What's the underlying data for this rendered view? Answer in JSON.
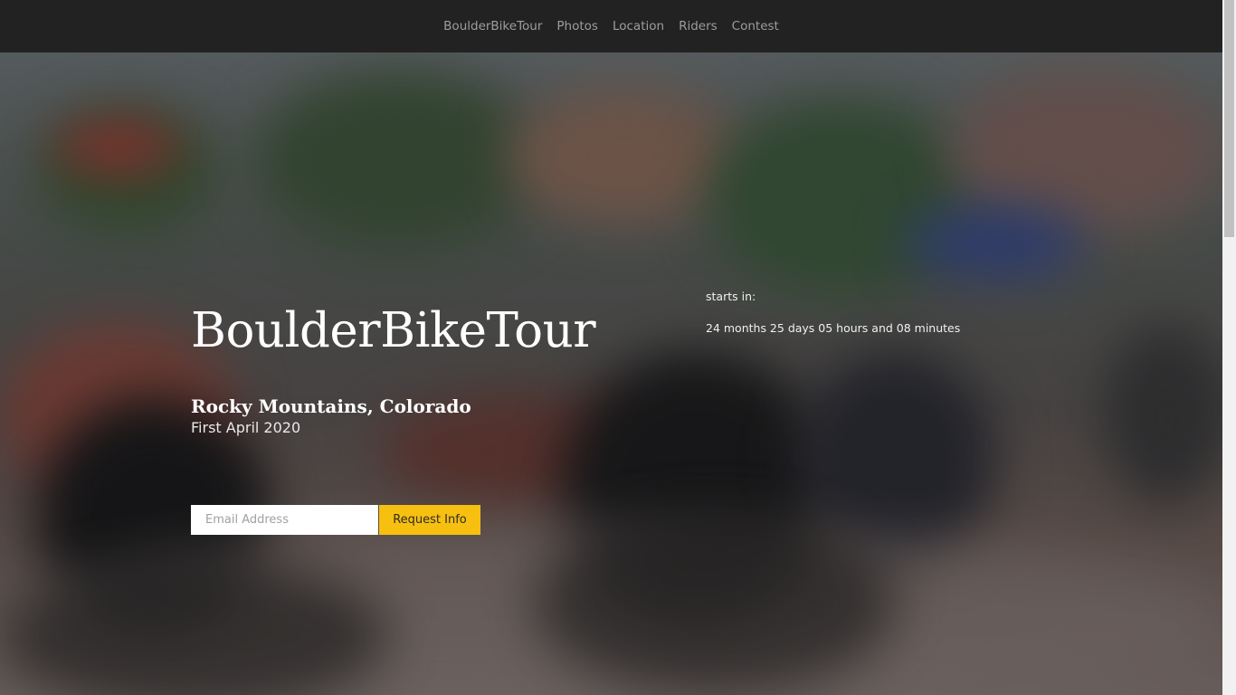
{
  "nav": {
    "items": [
      {
        "label": "BoulderBikeTour"
      },
      {
        "label": "Photos"
      },
      {
        "label": "Location"
      },
      {
        "label": "Riders"
      },
      {
        "label": "Contest"
      }
    ]
  },
  "hero": {
    "title": "BoulderBikeTour",
    "subtitle": "Rocky Mountains, Colorado",
    "date": "First April 2020",
    "email_placeholder": "Email Address",
    "request_label": "Request Info",
    "background_description_icon": "cyclists-photo"
  },
  "countdown": {
    "label": "starts in:",
    "value": "24 months 25 days 05 hours and 08 minutes"
  },
  "colors": {
    "nav_bg": "#222222",
    "accent": "#f7bf10",
    "nav_text": "#9d9d9d"
  }
}
